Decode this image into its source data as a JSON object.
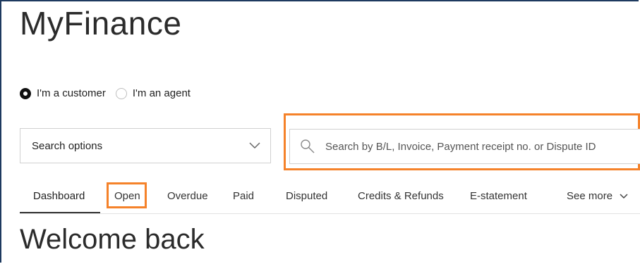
{
  "app": {
    "title": "MyFinance"
  },
  "role": {
    "options": [
      {
        "label": "I'm a customer",
        "selected": true
      },
      {
        "label": "I'm an agent",
        "selected": false
      }
    ]
  },
  "search": {
    "options_label": "Search options",
    "placeholder": "Search by B/L, Invoice, Payment receipt no. or Dispute ID"
  },
  "tabs": [
    {
      "label": "Dashboard",
      "active": true
    },
    {
      "label": "Open",
      "active": false
    },
    {
      "label": "Overdue",
      "active": false
    },
    {
      "label": "Paid",
      "active": false
    },
    {
      "label": "Disputed",
      "active": false
    },
    {
      "label": "Credits & Refunds",
      "active": false
    },
    {
      "label": "E-statement",
      "active": false
    },
    {
      "label": "See more",
      "active": false
    }
  ],
  "main": {
    "heading": "Welcome back"
  },
  "colors": {
    "highlight": "#f5822a",
    "frame": "#1e3a5f"
  },
  "icons": {
    "search": "search-icon",
    "dropdown": "chevron-down-icon"
  }
}
